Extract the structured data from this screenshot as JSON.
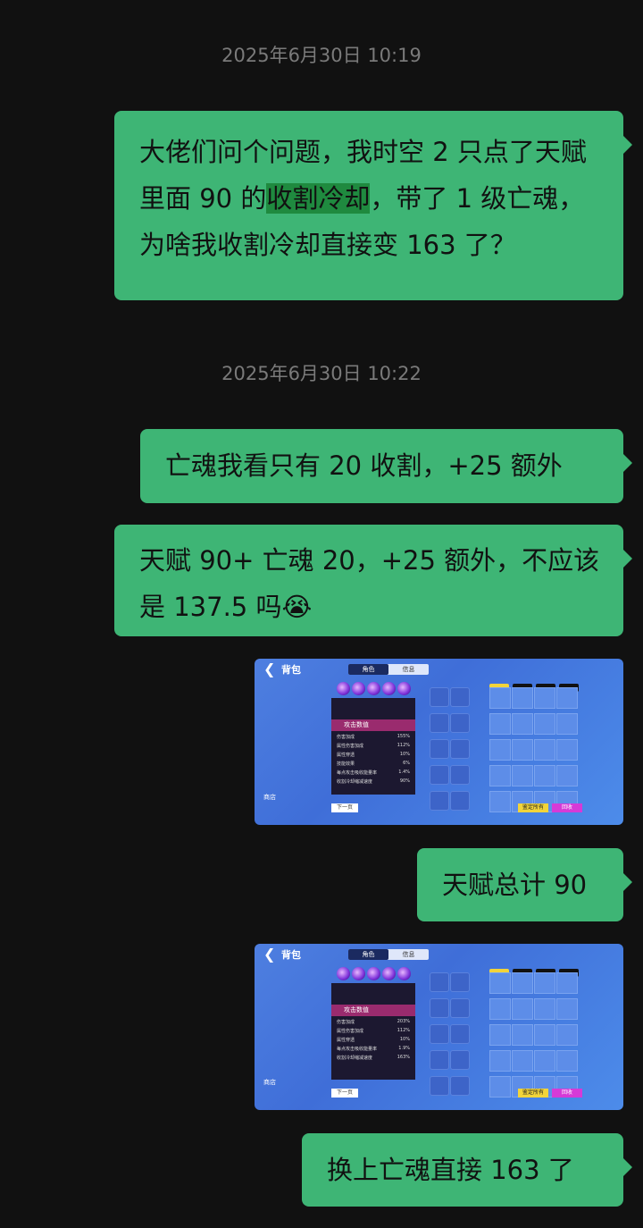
{
  "messages": [
    {
      "type": "timestamp",
      "text": "2025年6月30日 10:19"
    },
    {
      "type": "text",
      "before": "大佬们问个问题，我时空 2 只点了天赋里面 90 的",
      "highlight": "收割冷却",
      "after": "，带了 1 级亡魂，为啥我收割冷却直接变 163 了？"
    },
    {
      "type": "timestamp",
      "text": "2025年6月30日 10:22"
    },
    {
      "type": "text",
      "text": "亡魂我看只有 20 收割，+25 额外"
    },
    {
      "type": "text",
      "text": "天赋 90+ 亡魂 20，+25 额外，不应该是 137.5 吗😭"
    },
    {
      "type": "image"
    },
    {
      "type": "text",
      "text": "天赋总计 90"
    },
    {
      "type": "image"
    },
    {
      "type": "text",
      "text": "换上亡魂直接 163 了"
    }
  ],
  "shot1": {
    "back_label": "背包",
    "tabs": [
      "角色",
      "信息"
    ],
    "section": "攻击数值",
    "rows": [
      [
        "伤害加成",
        "155%"
      ],
      [
        "属性伤害加成",
        "112%"
      ],
      [
        "属性穿透",
        "10%"
      ],
      [
        "技能效果",
        "6%"
      ],
      [
        "每点攻击吸收能量率",
        "1.4%"
      ],
      [
        "收割冷却缩减速度",
        "90%"
      ]
    ],
    "buttons": {
      "next": "下一页",
      "all": "鉴定所有",
      "sell": "回收"
    },
    "shop": "商店"
  },
  "shot2": {
    "back_label": "背包",
    "tabs": [
      "角色",
      "信息"
    ],
    "section": "攻击数值",
    "rows": [
      [
        "伤害加成",
        "203%"
      ],
      [
        "属性伤害加成",
        "112%"
      ],
      [
        "属性穿透",
        "10%"
      ],
      [
        "每点攻击吸收能量率",
        "1.9%"
      ],
      [
        "收割冷却缩减速度",
        "163%"
      ]
    ],
    "buttons": {
      "next": "下一页",
      "all": "鉴定所有",
      "sell": "回收"
    },
    "shop": "商店"
  }
}
